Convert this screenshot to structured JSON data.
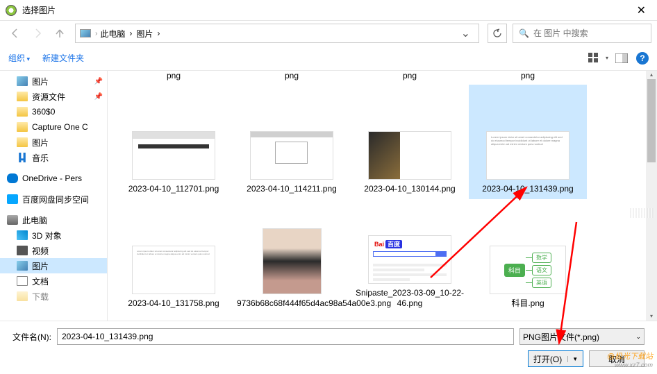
{
  "window": {
    "title": "选择图片"
  },
  "nav": {
    "path": [
      "此电脑",
      "图片"
    ],
    "search_placeholder": "在 图片 中搜索"
  },
  "toolbar": {
    "organize": "组织",
    "new_folder": "新建文件夹"
  },
  "sidebar": {
    "items": [
      {
        "label": "图片",
        "icon": "pic",
        "pinned": true
      },
      {
        "label": "资源文件",
        "icon": "folder",
        "pinned": true
      },
      {
        "label": "360$0",
        "icon": "folder"
      },
      {
        "label": "Capture One C",
        "icon": "folder"
      },
      {
        "label": "图片",
        "icon": "folder"
      },
      {
        "label": "音乐",
        "icon": "music"
      },
      {
        "label": "OneDrive - Pers",
        "icon": "cloud",
        "level": 0,
        "gap": true
      },
      {
        "label": "百度网盘同步空间",
        "icon": "baidu",
        "level": 0,
        "gap": true
      },
      {
        "label": "此电脑",
        "icon": "pc",
        "level": 0,
        "gap": true
      },
      {
        "label": "3D 对象",
        "icon": "d3"
      },
      {
        "label": "视频",
        "icon": "video"
      },
      {
        "label": "图片",
        "icon": "pic",
        "selected": true
      },
      {
        "label": "文档",
        "icon": "doc"
      },
      {
        "label": "下载",
        "icon": "folder",
        "cut": true
      }
    ]
  },
  "top_labels": [
    "png",
    "png",
    "png",
    "png"
  ],
  "files": [
    {
      "name": "2023-04-10_112701.png",
      "thumb": "app1"
    },
    {
      "name": "2023-04-10_114211.png",
      "thumb": "app2"
    },
    {
      "name": "2023-04-10_130144.png",
      "thumb": "photo-side"
    },
    {
      "name": "2023-04-10_131439.png",
      "thumb": "text",
      "selected": true
    },
    {
      "name": "2023-04-10_131758.png",
      "thumb": "text small"
    },
    {
      "name": "9736b68c68f444f65d4ac98a54a00e3.png",
      "thumb": "girl"
    },
    {
      "name": "Snipaste_2023-03-09_10-22-46.png",
      "thumb": "baidu"
    },
    {
      "name": "科目.png",
      "thumb": "mind"
    }
  ],
  "mind": {
    "root": "科目",
    "children": [
      "数学",
      "语文",
      "英语"
    ]
  },
  "footer": {
    "filename_label": "文件名(N):",
    "filename_value": "2023-04-10_131439.png",
    "filetype": "PNG图片文件(*.png)",
    "open": "打开(O)",
    "cancel": "取消"
  },
  "watermark": {
    "main": "@极光下载站",
    "sub": "www.xz7.com"
  }
}
